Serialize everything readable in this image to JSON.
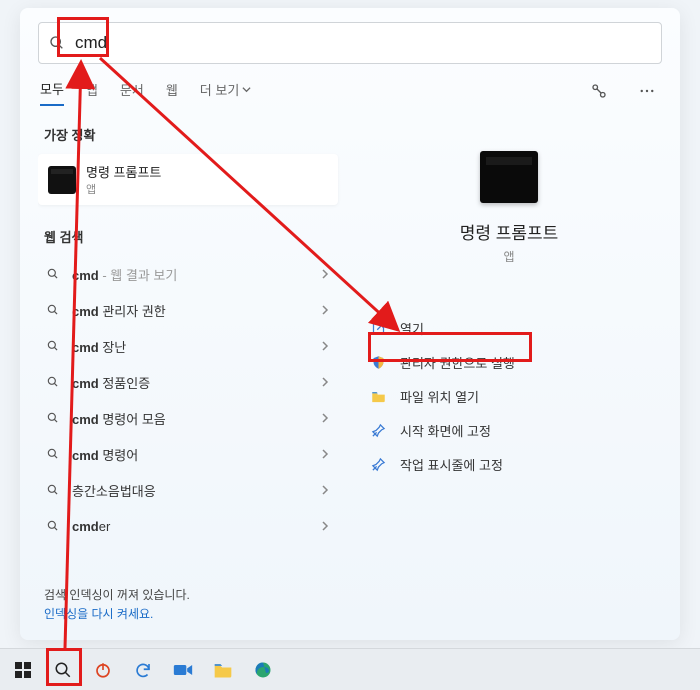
{
  "search": {
    "value": "cmd"
  },
  "tabs": {
    "items": [
      "모두",
      "앱",
      "문서",
      "웹",
      "더 보기"
    ],
    "active": 0
  },
  "left": {
    "bestMatchHeader": "가장 정확",
    "bestMatch": {
      "title": "명령 프롬프트",
      "subtitle": "앱"
    },
    "webHeader": "웹 검색",
    "suggestions": [
      {
        "bold": "cmd",
        "rest": " - 웹 결과 보기",
        "sub": true
      },
      {
        "bold": "cmd",
        "rest": " 관리자 권한"
      },
      {
        "bold": "cmd",
        "rest": " 장난"
      },
      {
        "bold": "cmd",
        "rest": " 정품인증"
      },
      {
        "bold": "cmd",
        "rest": " 명령어 모음"
      },
      {
        "bold": "cmd",
        "rest": " 명령어"
      },
      {
        "bold": "",
        "rest": "층간소음법대응"
      },
      {
        "bold": "cmd",
        "rest": "er"
      }
    ],
    "indexing": {
      "line1": "검색 인덱싱이 꺼져 있습니다.",
      "line2": "인덱싱을 다시 켜세요."
    }
  },
  "right": {
    "title": "명령 프롬프트",
    "subtitle": "앱",
    "actions": [
      {
        "icon": "open",
        "label": "열기"
      },
      {
        "icon": "shield",
        "label": "관리자 권한으로 실행"
      },
      {
        "icon": "folder",
        "label": "파일 위치 열기"
      },
      {
        "icon": "pin",
        "label": "시작 화면에 고정"
      },
      {
        "icon": "pin",
        "label": "작업 표시줄에 고정"
      }
    ]
  },
  "annotations": {
    "color": "#e21b1b"
  }
}
